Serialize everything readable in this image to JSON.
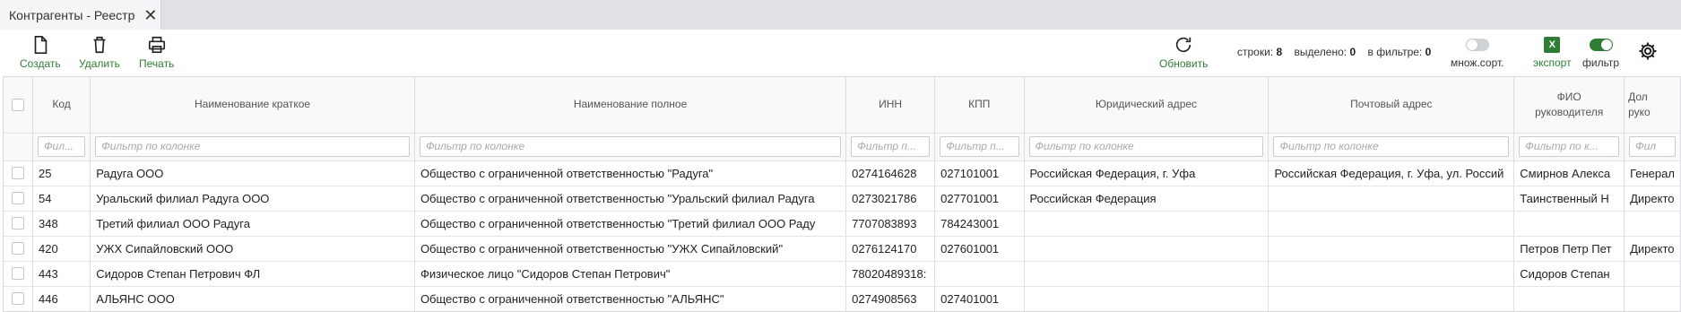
{
  "tab": {
    "title": "Контрагенты - Реестр",
    "close": "✕"
  },
  "toolbar": {
    "create": "Создать",
    "delete": "Удалить",
    "print": "Печать",
    "refresh": "Обновить",
    "stats": {
      "rows_label": "строки:",
      "rows_value": "8",
      "selected_label": "выделено:",
      "selected_value": "0",
      "filtered_label": "в фильтре:",
      "filtered_value": "0"
    },
    "multisort_label": "множ.сорт.",
    "multisort_on": false,
    "export_label": "экспорт",
    "export_icon_text": "X",
    "filter_label": "фильтр",
    "filter_on": true
  },
  "colors": {
    "accent": "#2e7d32",
    "tabstrip": "#dfe1e6"
  },
  "grid": {
    "headers": {
      "code": "Код",
      "short_name": "Наименование краткое",
      "full_name": "Наименование полное",
      "inn": "ИНН",
      "kpp": "КПП",
      "legal_address": "Юридический адрес",
      "postal_address": "Почтовый адрес",
      "director_fio_1": "ФИО",
      "director_fio_2": "руководителя",
      "director_pos_1": "Дол",
      "director_pos_2": "руко"
    },
    "filters": {
      "code": "Фил...",
      "short_name": "Фильтр по колонке",
      "full_name": "Фильтр по колонке",
      "inn": "Фильтр п...",
      "kpp": "Фильтр п...",
      "legal_address": "Фильтр по колонке",
      "postal_address": "Фильтр по колонке",
      "director_fio": "Фильтр по к...",
      "director_pos": "Фил"
    },
    "rows": [
      {
        "code": "25",
        "short_name": "Радуга ООО",
        "full_name": "Общество с ограниченной ответственностью \"Радуга\"",
        "inn": "0274164628",
        "kpp": "027101001",
        "legal_address": "Российская Федерация, г. Уфа",
        "postal_address": "Российская Федерация, г. Уфа, ул. Россий",
        "director_fio": "Смирнов Алекса",
        "director_pos": "Генерал"
      },
      {
        "code": "54",
        "short_name": "Уральский филиал Радуга ООО",
        "full_name": "Общество с ограниченной ответственностью \"Уральский филиал Радуга",
        "inn": "0273021786",
        "kpp": "027701001",
        "legal_address": "Российская Федерация",
        "postal_address": "",
        "director_fio": "Таинственный Н",
        "director_pos": "Директо"
      },
      {
        "code": "348",
        "short_name": "Третий филиал ООО Радуга",
        "full_name": "Общество с ограниченной ответственностью \"Третий филиал ООО Раду",
        "inn": "7707083893",
        "kpp": "784243001",
        "legal_address": "",
        "postal_address": "",
        "director_fio": "",
        "director_pos": ""
      },
      {
        "code": "420",
        "short_name": "УЖХ Сипайловский ООО",
        "full_name": "Общество с ограниченной ответственностью \"УЖХ Сипайловский\"",
        "inn": "0276124170",
        "kpp": "027601001",
        "legal_address": "",
        "postal_address": "",
        "director_fio": "Петров Петр Пет",
        "director_pos": "Директо"
      },
      {
        "code": "443",
        "short_name": "Сидоров Степан Петрович ФЛ",
        "full_name": "Физическое лицо \"Сидоров Степан Петрович\"",
        "inn": "78020489318:",
        "kpp": "",
        "legal_address": "",
        "postal_address": "",
        "director_fio": "Сидоров Степан",
        "director_pos": ""
      },
      {
        "code": "446",
        "short_name": "АЛЬЯНС ООО",
        "full_name": "Общество с ограниченной ответственностью \"АЛЬЯНС\"",
        "inn": "0274908563",
        "kpp": "027401001",
        "legal_address": "",
        "postal_address": "",
        "director_fio": "",
        "director_pos": ""
      }
    ]
  }
}
